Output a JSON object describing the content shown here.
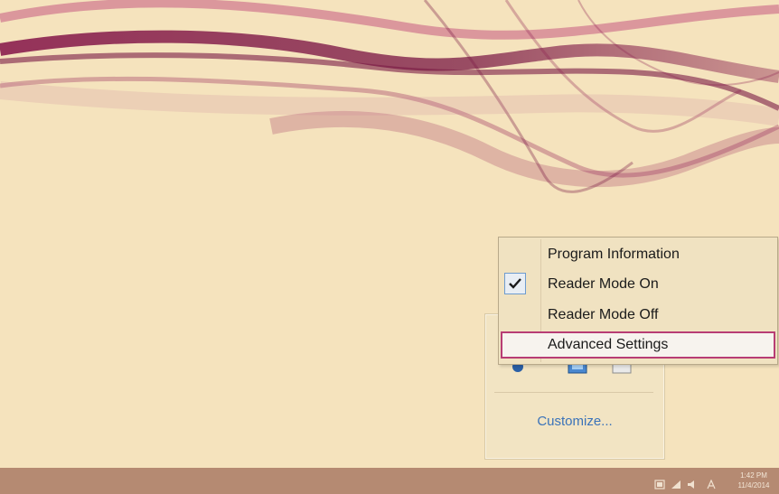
{
  "context_menu": {
    "items": [
      {
        "label": "Program Information",
        "checked": false
      },
      {
        "label": "Reader Mode On",
        "checked": true
      },
      {
        "label": "Reader Mode Off",
        "checked": false
      },
      {
        "label": "Advanced Settings",
        "checked": false,
        "highlighted": true
      }
    ]
  },
  "tray_flyout": {
    "customize_label": "Customize...",
    "icons": [
      "blue-circle-icon",
      "network-monitor-icon",
      "window-app-icon"
    ]
  },
  "taskbar": {
    "tray_icons": [
      "action-center-icon",
      "network-icon",
      "volume-icon",
      "reader-mode-icon"
    ],
    "clock": {
      "time": "1:42 PM",
      "date": "11/4/2014"
    }
  },
  "colors": {
    "desktop_background": "#f5e3bd",
    "swirl": "#8a1e4e",
    "taskbar": "#b58a72",
    "highlight_border": "#b83d74",
    "link": "#3b73b9"
  }
}
